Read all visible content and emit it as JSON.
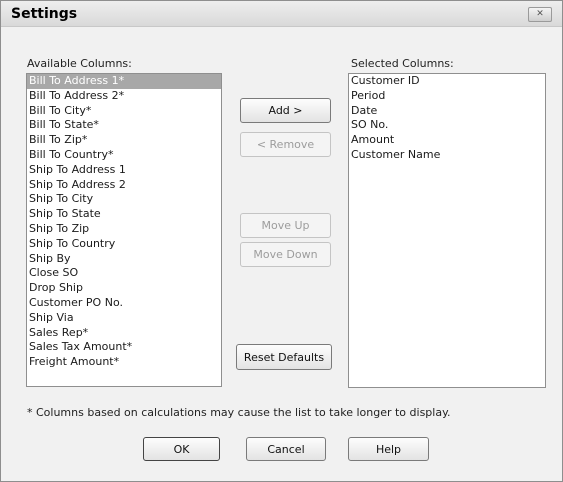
{
  "window": {
    "title": "Settings",
    "close_glyph": "✕"
  },
  "available": {
    "label": "Available Columns:",
    "items": [
      "Bill To Address 1*",
      "Bill To Address 2*",
      "Bill To City*",
      "Bill To State*",
      "Bill To Zip*",
      "Bill To Country*",
      "Ship To Address 1",
      "Ship To Address 2",
      "Ship To City",
      "Ship To State",
      "Ship To Zip",
      "Ship To Country",
      "Ship By",
      "Close SO",
      "Drop Ship",
      "Customer PO No.",
      "Ship Via",
      "Sales Rep*",
      "Sales Tax Amount*",
      "Freight Amount*"
    ],
    "selected_item": "Bill To Address 1*"
  },
  "selected": {
    "label": "Selected Columns:",
    "items": [
      "Customer ID",
      "Period",
      "Date",
      "SO No.",
      "Amount",
      "Customer Name"
    ]
  },
  "buttons": {
    "add": "Add >",
    "remove": "< Remove",
    "move_up": "Move Up",
    "move_down": "Move Down",
    "reset_defaults": "Reset Defaults",
    "ok": "OK",
    "cancel": "Cancel",
    "help": "Help"
  },
  "footnote": "* Columns based on calculations may cause the list to take longer to display."
}
